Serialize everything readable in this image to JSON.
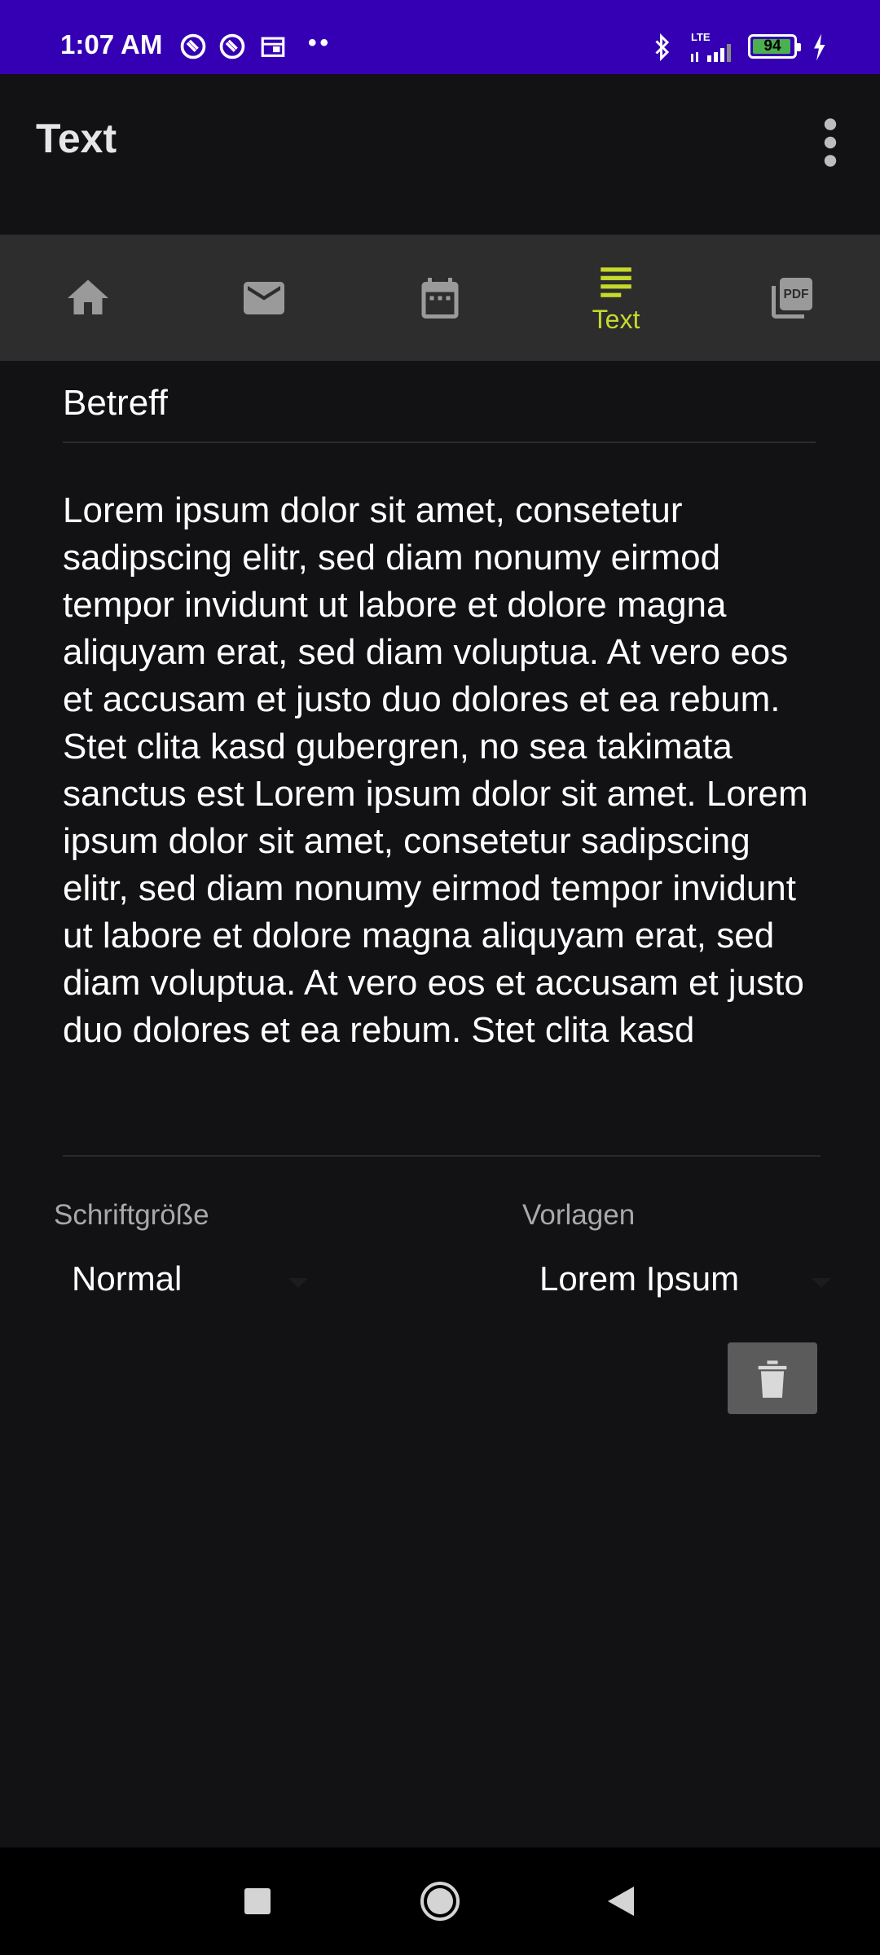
{
  "status_bar": {
    "time": "1:07 AM",
    "dots": "••",
    "network": "LTE",
    "battery_level": "94",
    "icons": [
      "sync-icon",
      "sync-icon",
      "calendar-icon",
      "bluetooth-icon",
      "signal-icon",
      "battery-icon",
      "charging-icon"
    ]
  },
  "app_bar": {
    "title": "Text",
    "menu_icon": "more-vert-icon"
  },
  "tabs": [
    {
      "icon": "home-icon",
      "label": "",
      "active": false
    },
    {
      "icon": "mail-icon",
      "label": "",
      "active": false
    },
    {
      "icon": "calendar-icon",
      "label": "",
      "active": false
    },
    {
      "icon": "text-lines-icon",
      "label": "Text",
      "active": true
    },
    {
      "icon": "pdf-icon",
      "label": "",
      "active": false
    }
  ],
  "form": {
    "subject_placeholder": "Betreff",
    "body_text": "Lorem ipsum dolor sit amet, consetetur sadipscing elitr, sed diam nonumy eirmod tempor invidunt ut labore et dolore magna aliquyam erat, sed diam voluptua. At vero eos et accusam et justo duo dolores et ea rebum. Stet clita kasd gubergren, no sea takimata sanctus est Lorem ipsum dolor sit amet. Lorem ipsum dolor sit amet, consetetur sadipscing elitr, sed diam nonumy eirmod tempor invidunt ut labore et dolore magna aliquyam erat, sed diam voluptua. At vero eos et accusam et justo duo dolores et ea rebum. Stet clita kasd",
    "font_size_label": "Schriftgröße",
    "font_size_value": "Normal",
    "templates_label": "Vorlagen",
    "templates_value": "Lorem Ipsum",
    "delete_icon": "trash-icon"
  },
  "colors": {
    "status_bar": "#3500b3",
    "background": "#121113",
    "tab_bar": "#2d2d2e",
    "active_tab": "#c6da2a",
    "inactive_icon": "#9a9a9a"
  },
  "nav_bar": {
    "buttons": [
      "recent-apps-icon",
      "home-circle-icon",
      "back-icon"
    ]
  }
}
